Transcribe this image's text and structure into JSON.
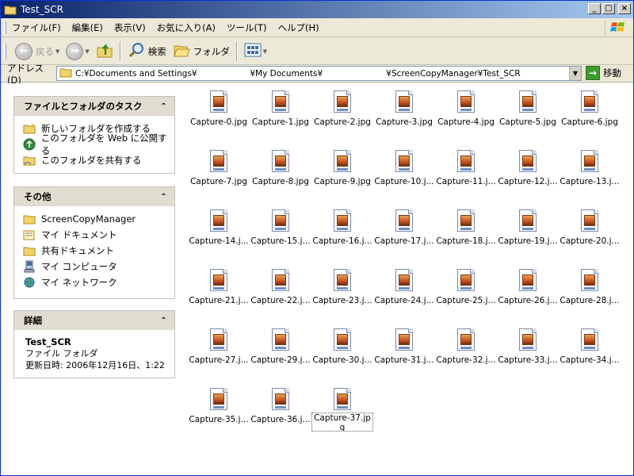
{
  "window": {
    "title": "Test_SCR"
  },
  "menu": [
    "ファイル(F)",
    "編集(E)",
    "表示(V)",
    "お気に入り(A)",
    "ツール(T)",
    "ヘルプ(H)"
  ],
  "toolbar": {
    "back": "戻る",
    "search": "検索",
    "folders": "フォルダ"
  },
  "address": {
    "label": "アドレス(D)",
    "path": "C:¥Documents and Settings¥                    ¥My Documents¥                        ¥ScreenCopyManager¥Test_SCR",
    "go": "移動"
  },
  "tasks": {
    "title": "ファイルとフォルダのタスク",
    "items": [
      "新しいフォルダを作成する",
      "このフォルダを Web に公開する",
      "このフォルダを共有する"
    ]
  },
  "other": {
    "title": "その他",
    "items": [
      "ScreenCopyManager",
      "マイ ドキュメント",
      "共有ドキュメント",
      "マイ コンピュータ",
      "マイ ネットワーク"
    ]
  },
  "details": {
    "title": "詳細",
    "name": "Test_SCR",
    "type": "ファイル フォルダ",
    "modified": "更新日時: 2006年12月16日、1:22"
  },
  "files": [
    "Capture-0.jpg",
    "Capture-1.jpg",
    "Capture-2.jpg",
    "Capture-3.jpg",
    "Capture-4.jpg",
    "Capture-5.jpg",
    "Capture-6.jpg",
    "Capture-7.jpg",
    "Capture-8.jpg",
    "Capture-9.jpg",
    "Capture-10.j...",
    "Capture-11.j...",
    "Capture-12.j...",
    "Capture-13.j...",
    "Capture-14.j...",
    "Capture-15.j...",
    "Capture-16.j...",
    "Capture-17.j...",
    "Capture-18.j...",
    "Capture-19.j...",
    "Capture-20.j...",
    "Capture-21.j...",
    "Capture-22.j...",
    "Capture-23.j...",
    "Capture-24.j...",
    "Capture-25.j...",
    "Capture-26.j...",
    "Capture-28.j...",
    "Capture-27.j...",
    "Capture-29.j...",
    "Capture-30.j...",
    "Capture-31.j...",
    "Capture-32.j...",
    "Capture-33.j...",
    "Capture-34.j...",
    "Capture-35.j...",
    "Capture-36.j...",
    "Capture-37.jpg"
  ],
  "selected_file": "Capture-37.jpg",
  "icons": {
    "title": "folder-icon",
    "back": "back-arrow-icon",
    "forward": "forward-arrow-icon",
    "up": "folder-up-icon",
    "search": "magnifier-icon",
    "folders": "folders-icon",
    "views": "views-icon",
    "file": "jpeg-file-icon"
  },
  "colors": {
    "titlebar_start": "#0a246a",
    "titlebar_end": "#a6caf0",
    "link": "#000000"
  }
}
